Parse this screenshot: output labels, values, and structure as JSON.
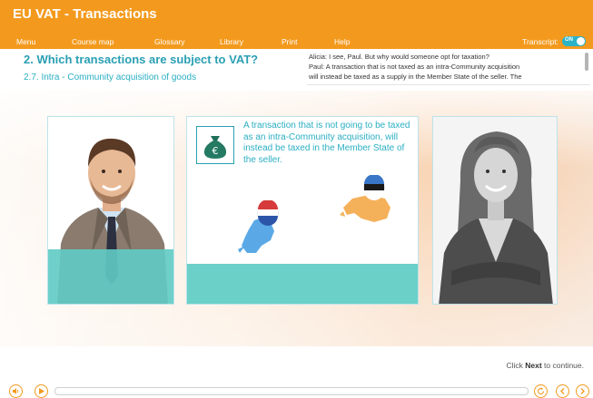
{
  "app": {
    "title": "EU VAT - Transactions"
  },
  "menu": {
    "items": [
      {
        "label": "Menu"
      },
      {
        "label": "Course map"
      },
      {
        "label": "Glossary"
      },
      {
        "label": "Library"
      },
      {
        "label": "Print"
      },
      {
        "label": "Help"
      }
    ],
    "transcript_label": "Transcript:",
    "transcript_toggle": "ON"
  },
  "section": {
    "title": "2. Which transactions are subject to VAT?",
    "subtitle": "2.7. Intra - Community acquisition of goods"
  },
  "transcript": {
    "lines": [
      "Alicia: I see, Paul. But why would someone opt for taxation?",
      "Paul: A transaction that is not taxed as an intra-Community acquisition",
      "will instead be taxed as a supply in the Member State of the seller. The"
    ]
  },
  "slide": {
    "text": "A transaction that is not going to be taxed as an intra-Community acquisition, will instead be taxed in the Member State of the seller.",
    "money_symbol": "€"
  },
  "footer": {
    "continue_prefix": "Click ",
    "continue_bold": "Next",
    "continue_suffix": " to continue."
  },
  "colors": {
    "brand_orange": "#f39a1e",
    "accent_teal": "#2aaec2",
    "map_blue": "#5aa9e6",
    "map_orange": "#f5b15a"
  },
  "icons": {
    "play": "play-icon",
    "audio": "audio-icon",
    "replay": "replay-icon",
    "prev": "chevron-left-icon",
    "next": "chevron-right-icon"
  }
}
